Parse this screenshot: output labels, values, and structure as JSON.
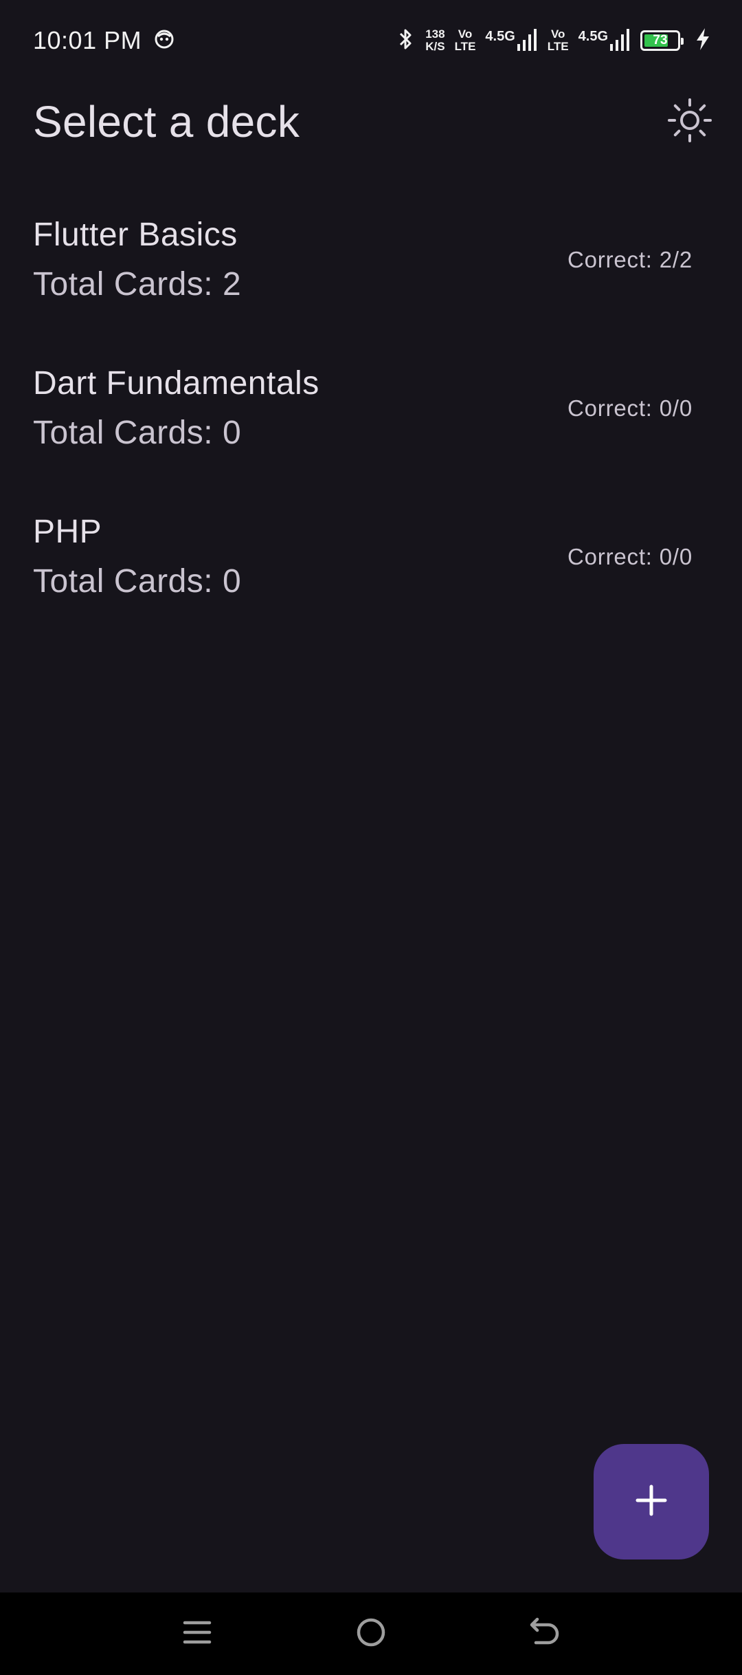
{
  "status_bar": {
    "time": "10:01 PM",
    "net_speed_value": "138",
    "net_speed_unit": "K/S",
    "sim1_volte_top": "Vo",
    "sim1_volte_bottom": "LTE",
    "sim1_network": "4.5G",
    "sim2_volte_top": "Vo",
    "sim2_volte_bottom": "LTE",
    "sim2_network": "4.5G",
    "battery_level": "73",
    "battery_color": "#33c24d"
  },
  "app_bar": {
    "title": "Select a deck",
    "theme_toggle_icon": "sun-icon"
  },
  "decks": [
    {
      "name": "Flutter Basics",
      "total_cards": "Total Cards: 2",
      "correct": "Correct: 2/2"
    },
    {
      "name": "Dart Fundamentals",
      "total_cards": "Total Cards: 0",
      "correct": "Correct: 0/0"
    },
    {
      "name": "PHP",
      "total_cards": "Total Cards: 0",
      "correct": "Correct: 0/0"
    }
  ],
  "fab": {
    "icon": "plus-icon",
    "color": "#4f378b"
  },
  "nav_bar": {
    "recents_icon": "menu-icon",
    "home_icon": "home-circle-icon",
    "back_icon": "back-icon"
  },
  "colors": {
    "background": "#16141b",
    "text_primary": "#e6e1e9",
    "text_secondary": "#cac4d0"
  }
}
